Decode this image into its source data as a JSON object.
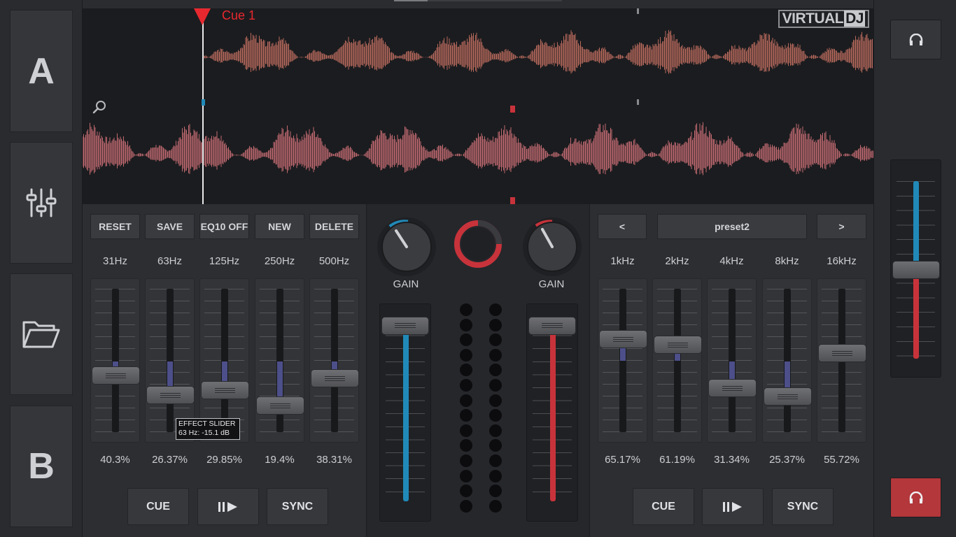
{
  "app": {
    "logo_text": "VIRTUAL",
    "logo_accent": "DJ"
  },
  "leftbar": {
    "deck_a_label": "A",
    "deck_b_label": "B",
    "icons": [
      "mixer-sliders-icon",
      "folder-open-icon"
    ]
  },
  "waveform": {
    "cue_label": "Cue 1",
    "zoom_icon": "magnifier-icon",
    "cue_color": "#e8282f"
  },
  "left_panel": {
    "buttons": [
      "RESET",
      "SAVE",
      "EQ10 OFF",
      "NEW",
      "DELETE"
    ],
    "bands": [
      {
        "freq": "31Hz",
        "pct": "40.3%",
        "level": 0.403
      },
      {
        "freq": "63Hz",
        "pct": "26.37%",
        "level": 0.2637
      },
      {
        "freq": "125Hz",
        "pct": "29.85%",
        "level": 0.2985
      },
      {
        "freq": "250Hz",
        "pct": "19.4%",
        "level": 0.194
      },
      {
        "freq": "500Hz",
        "pct": "38.31%",
        "level": 0.3831
      }
    ],
    "tooltip": {
      "line1": "EFFECT SLIDER",
      "line2": "63 Hz: -15.1 dB"
    },
    "transport": {
      "cue": "CUE",
      "play_icon": "play-pause-icon",
      "sync": "SYNC"
    }
  },
  "right_panel": {
    "prev": "<",
    "preset": "preset2",
    "next": ">",
    "bands": [
      {
        "freq": "1kHz",
        "pct": "65.17%",
        "level": 0.6517
      },
      {
        "freq": "2kHz",
        "pct": "61.19%",
        "level": 0.6119
      },
      {
        "freq": "4kHz",
        "pct": "31.34%",
        "level": 0.3134
      },
      {
        "freq": "8kHz",
        "pct": "25.37%",
        "level": 0.2537
      },
      {
        "freq": "16kHz",
        "pct": "55.72%",
        "level": 0.5572
      }
    ],
    "transport": {
      "cue": "CUE",
      "play_icon": "play-pause-icon",
      "sync": "SYNC"
    }
  },
  "mixer": {
    "gain_left": "GAIN",
    "gain_right": "GAIN",
    "left_color": "#2189b8",
    "right_color": "#c8333b"
  },
  "rightbar": {
    "headphone_icon": "headphones-icon",
    "active_color": "#b3373b"
  }
}
